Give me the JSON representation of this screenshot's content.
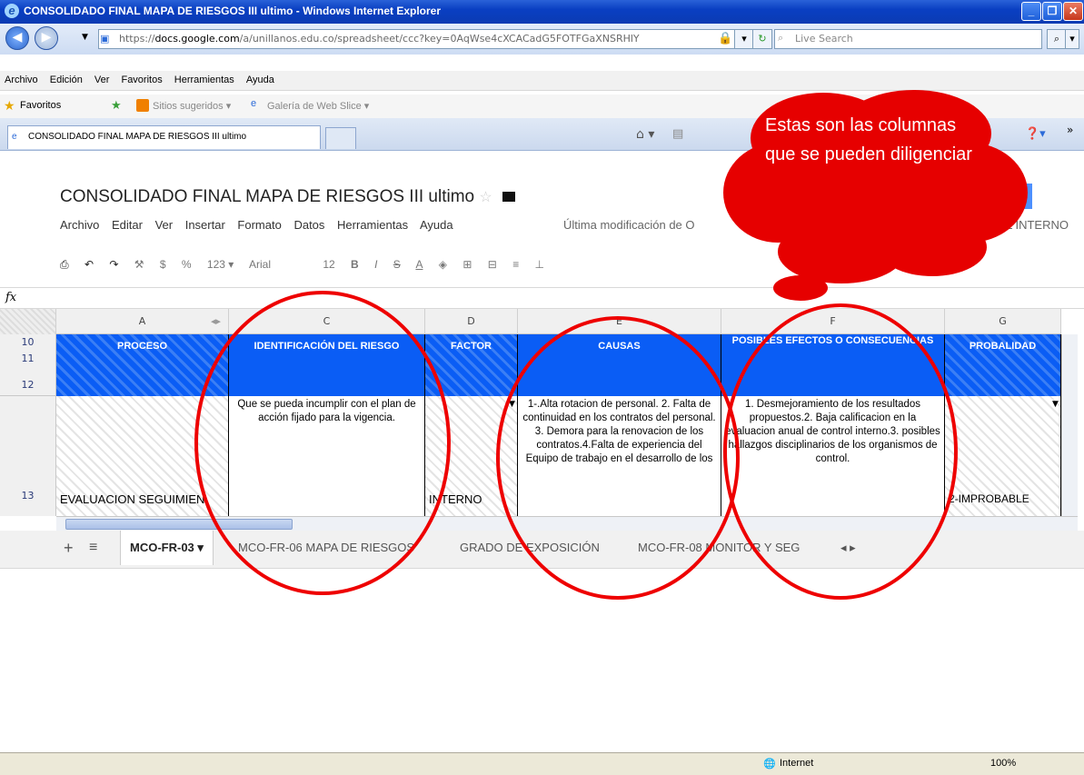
{
  "window": {
    "title": "CONSOLIDADO FINAL MAPA DE RIESGOS III ultimo - Windows Internet Explorer"
  },
  "address": {
    "prefix": "https://",
    "domain": "docs.google.com",
    "path": "/a/unillanos.edu.co/spreadsheet/ccc?key=0AqWse4cXCACadG5FOTFGaXNSRHlY",
    "search_placeholder": "Live Search"
  },
  "menu": [
    "Archivo",
    "Edición",
    "Ver",
    "Favoritos",
    "Herramientas",
    "Ayuda"
  ],
  "favorites": {
    "label": "Favoritos",
    "suggested": "Sitios sugeridos ▾",
    "webslice": "Galería de Web Slice ▾"
  },
  "tab": {
    "label": "CONSOLIDADO FINAL MAPA DE RIESGOS III ultimo"
  },
  "doc": {
    "title": "CONSOLIDADO FINAL MAPA DE RIESGOS III ultimo",
    "menu": [
      "Archivo",
      "Editar",
      "Ver",
      "Insertar",
      "Formato",
      "Datos",
      "Herramientas",
      "Ayuda"
    ],
    "last_modified": "Última modificación de O",
    "right_label": "OL INTERNO"
  },
  "toolbar": {
    "font": "Arial",
    "size": "12",
    "currency": "$",
    "percent": "%",
    "number": "123 ▾"
  },
  "formula": {
    "label": "fx"
  },
  "columns": [
    "A",
    "C",
    "D",
    "E",
    "F",
    "G"
  ],
  "rows": [
    "10",
    "11",
    "12",
    "13"
  ],
  "headers": {
    "a": "PROCESO",
    "c": "IDENTIFICACIÓN DEL RIESGO",
    "d": "FACTOR",
    "e": "CAUSAS",
    "f": "POSIBLES EFECTOS O CONSECUENCIAS",
    "g": "PROBALIDAD"
  },
  "cells": {
    "a": "EVALUACION SEGUIMIEN",
    "c": "Que se pueda incumplir con el plan de acción fijado para la vigencia.",
    "d": "INTERNO",
    "e": "1-.Alta rotacion de personal. 2. Falta de continuidad en los contratos del personal. 3. Demora para la renovacion de los contratos.4.Falta de experiencia del Equipo de trabajo en el desarrollo de los",
    "f": "1. Desmejoramiento de los resultados propuestos.2. Baja calificacion en la evaluacion anual de control interno.3. posibles hallazgos disciplinarios de los organismos de control.",
    "g": "2-IMPROBABLE"
  },
  "sheets": [
    "MCO-FR-03 ▾",
    "MCO-FR-06 MAPA DE RIESGOS",
    "GRADO DE EXPOSICIÓN",
    "MCO-FR-08 MONITOR Y SEG"
  ],
  "status": {
    "zone": "Internet",
    "zoom": "100%"
  },
  "callout": {
    "text": "Estas son las columnas que se pueden diligenciar",
    "color": "#e00000"
  }
}
